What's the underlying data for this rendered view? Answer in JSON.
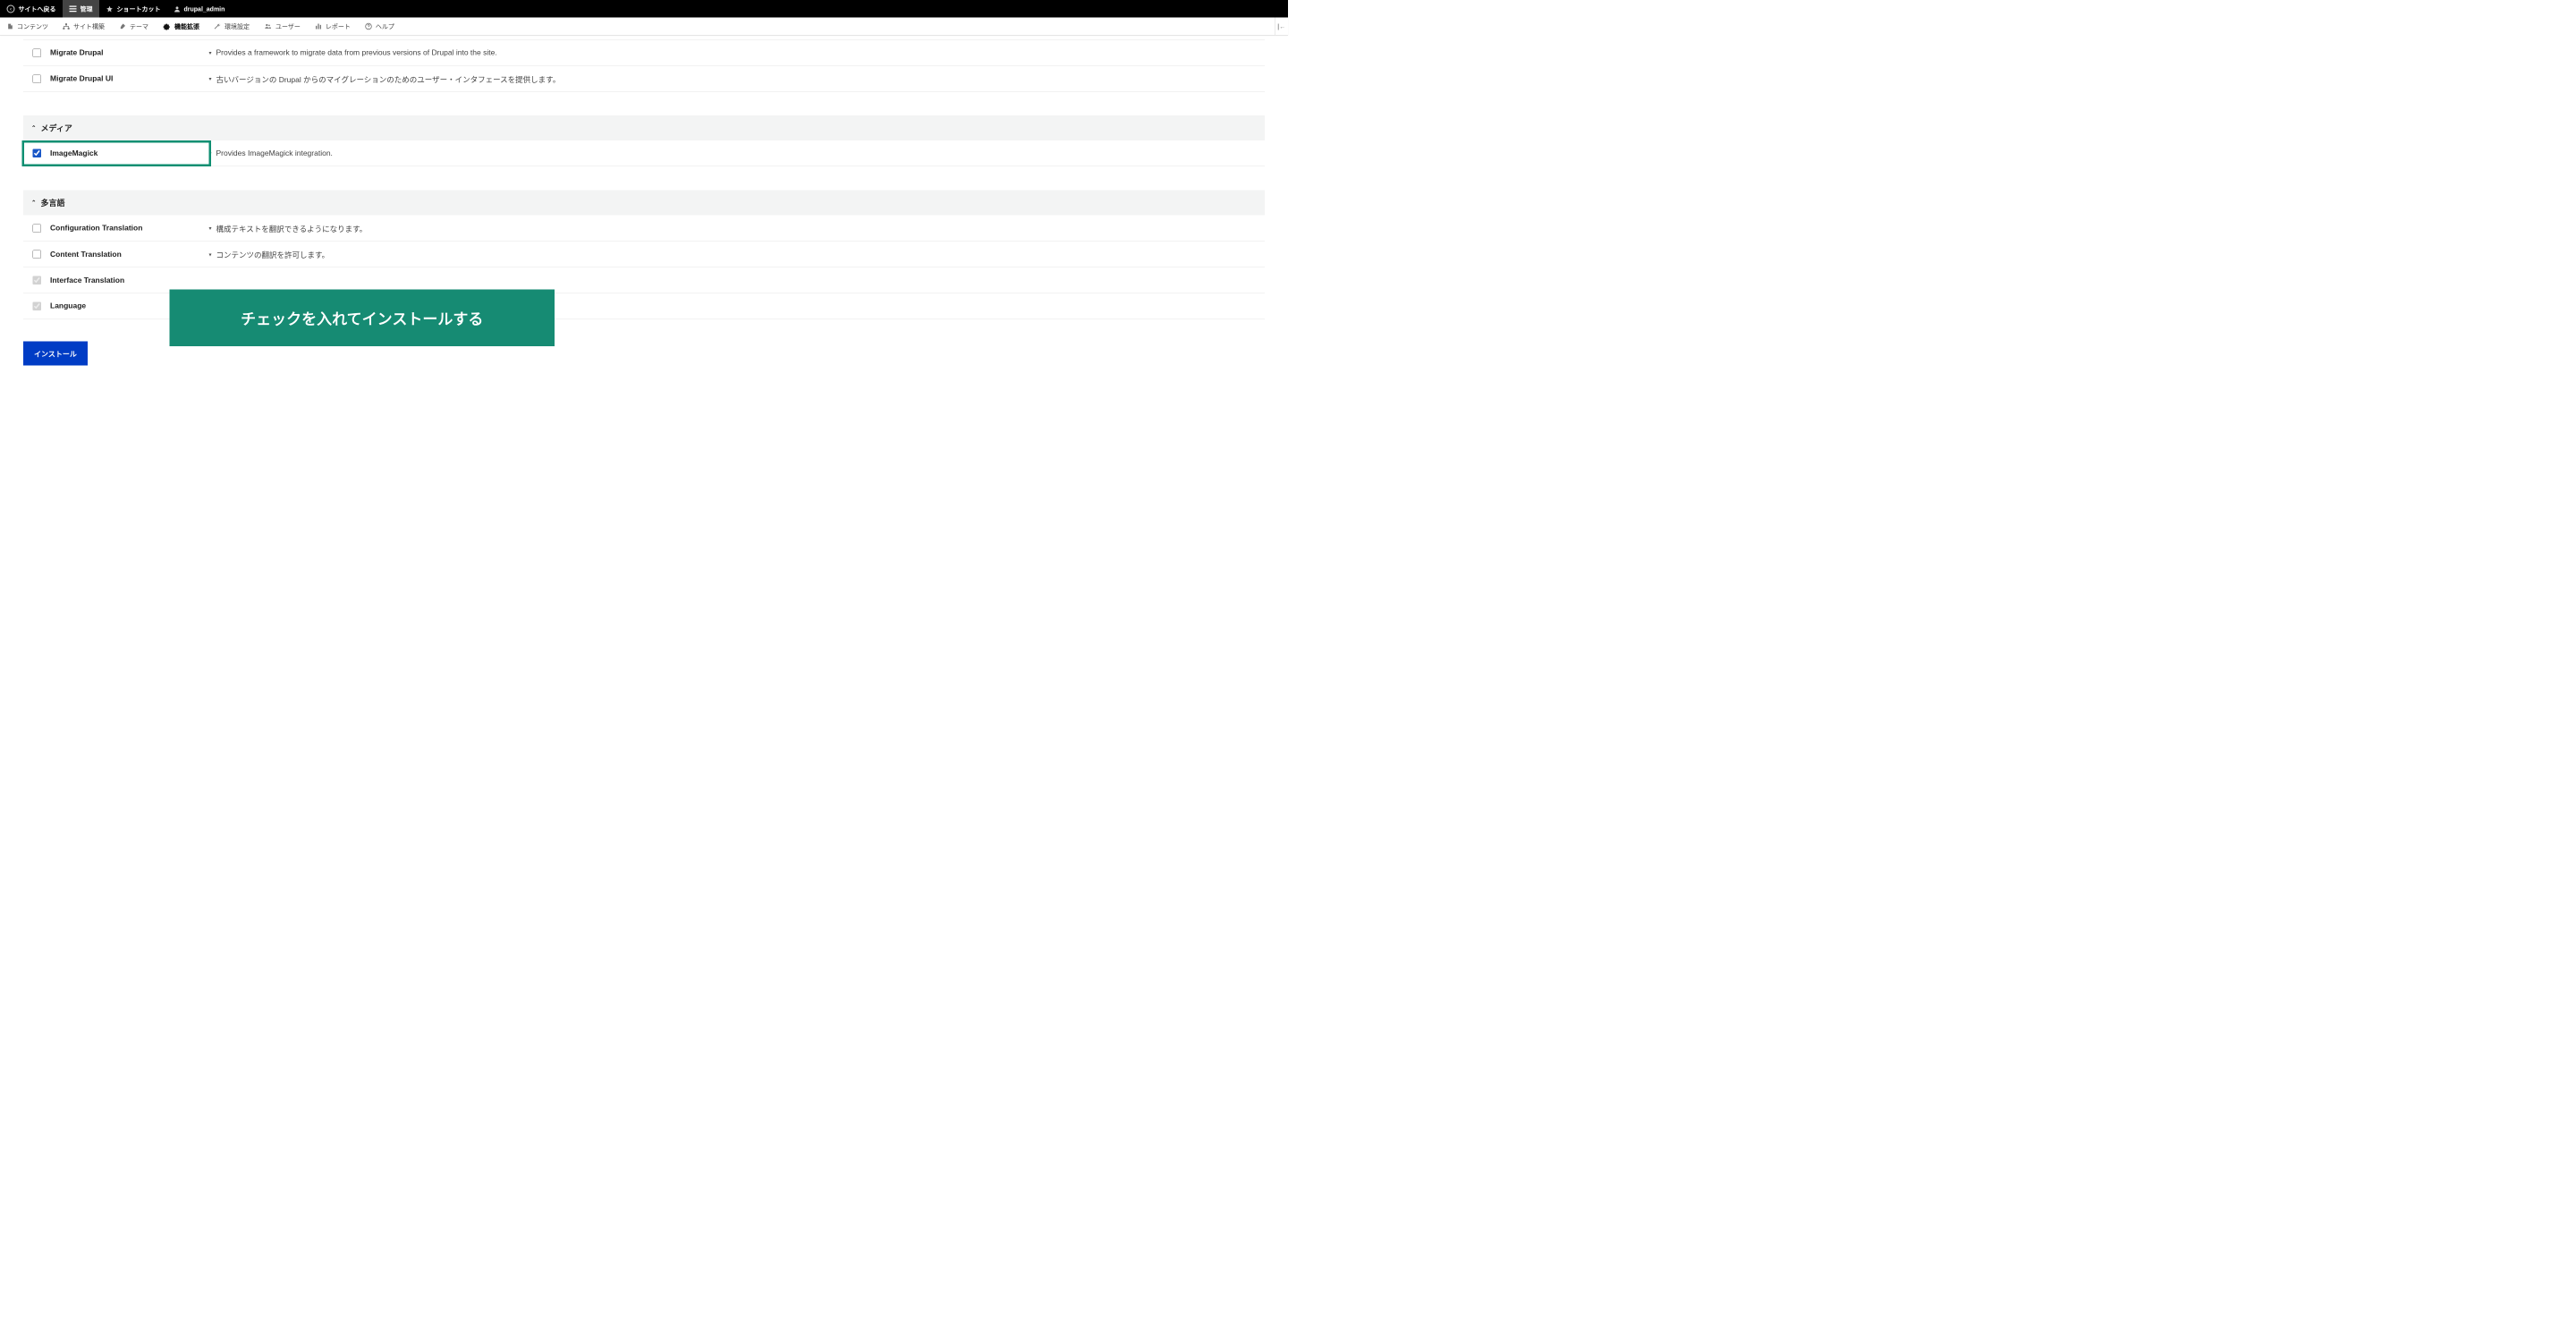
{
  "topbar": {
    "back": "サイトへ戻る",
    "manage": "管理",
    "shortcuts": "ショートカット",
    "user": "drupal_admin"
  },
  "secbar": {
    "content": "コンテンツ",
    "structure": "サイト構築",
    "themes": "テーマ",
    "extend": "機能拡張",
    "config": "環境設定",
    "users": "ユーザー",
    "reports": "レポート",
    "help": "ヘルプ"
  },
  "top_modules": [
    {
      "name": "Migrate Drupal",
      "desc": "Provides a framework to migrate data from previous versions of Drupal into the site.",
      "checked": false,
      "locked": false
    },
    {
      "name": "Migrate Drupal UI",
      "desc": "古いバージョンの Drupal からのマイグレーションのためのユーザー・インタフェースを提供します。",
      "checked": false,
      "locked": false
    }
  ],
  "section_media": {
    "title": "メディア",
    "modules": [
      {
        "name": "ImageMagick",
        "desc": "Provides ImageMagick integration.",
        "checked": true,
        "locked": false,
        "highlighted": true
      }
    ]
  },
  "section_multilang": {
    "title": "多言語",
    "modules": [
      {
        "name": "Configuration Translation",
        "desc": "構成テキストを翻訳できるようになります。",
        "checked": false,
        "locked": false
      },
      {
        "name": "Content Translation",
        "desc": "コンテンツの翻訳を許可します。",
        "checked": false,
        "locked": false
      },
      {
        "name": "Interface Translation",
        "desc": "",
        "checked": true,
        "locked": true
      },
      {
        "name": "Language",
        "desc": "",
        "checked": true,
        "locked": true
      }
    ]
  },
  "install_button": "インストール",
  "annotation": "チェックを入れてインストールする"
}
